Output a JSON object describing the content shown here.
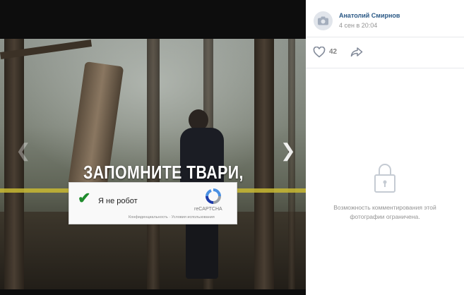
{
  "photo": {
    "caption": "ЗАПОМНИТЕ ТВАРИ,"
  },
  "recaptcha": {
    "checkbox_label": "Я не робот",
    "brand": "reCAPTCHA",
    "links": "Конфиденциальность · Условия использования"
  },
  "sidebar": {
    "author": "Анатолий Смирнов",
    "date": "4 сен в 20:04",
    "likes": "42",
    "comments_notice": "Возможность комментирования этой фотографии ограничена."
  },
  "colors": {
    "link": "#2a5885",
    "muted": "#939393",
    "check": "#1f8b2c"
  }
}
